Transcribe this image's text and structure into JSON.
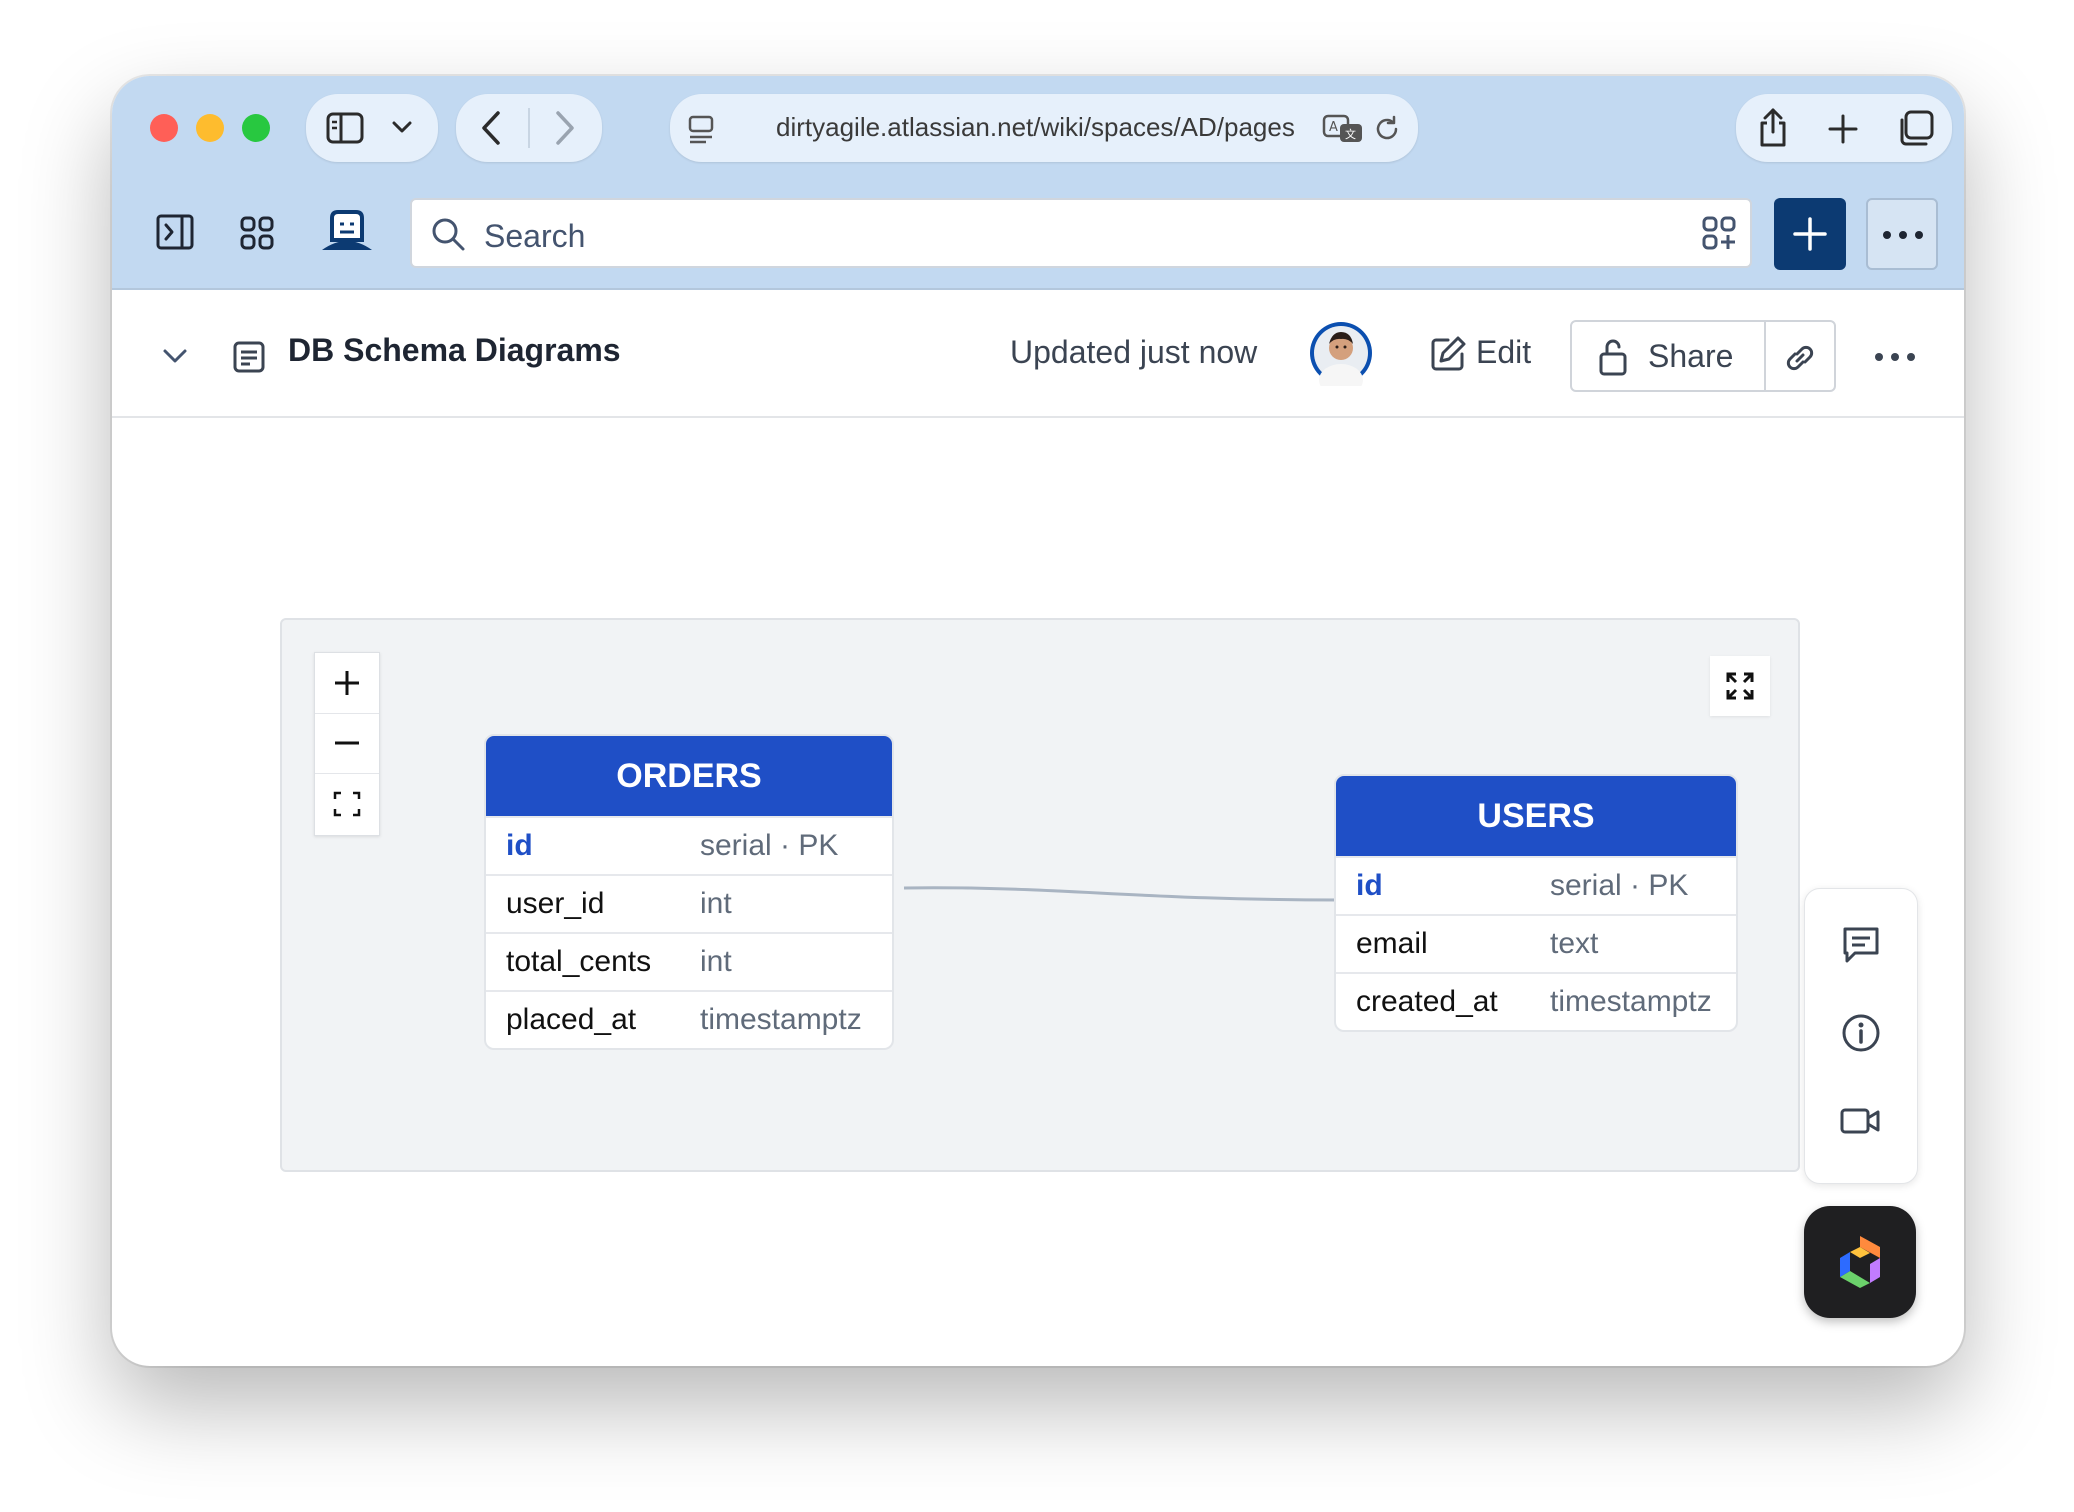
{
  "browser": {
    "url": "dirtyagile.atlassian.net/wiki/spaces/AD/pages",
    "search_placeholder": "Search"
  },
  "page": {
    "title": "DB Schema Diagrams",
    "updated": "Updated just now",
    "edit_label": "Edit",
    "share_label": "Share"
  },
  "diagram": {
    "tables": [
      {
        "name": "ORDERS",
        "columns": [
          {
            "name": "id",
            "type": "serial · PK"
          },
          {
            "name": "user_id",
            "type": "int"
          },
          {
            "name": "total_cents",
            "type": "int"
          },
          {
            "name": "placed_at",
            "type": "timestamptz"
          }
        ]
      },
      {
        "name": "USERS",
        "columns": [
          {
            "name": "id",
            "type": "serial · PK"
          },
          {
            "name": "email",
            "type": "text"
          },
          {
            "name": "created_at",
            "type": "timestamptz"
          }
        ]
      }
    ],
    "relationship": {
      "from": "ORDERS",
      "to": "USERS"
    }
  },
  "colors": {
    "chrome": "#c2d9f1",
    "accent": "#1f4fc6",
    "create_button": "#0c3a72"
  }
}
